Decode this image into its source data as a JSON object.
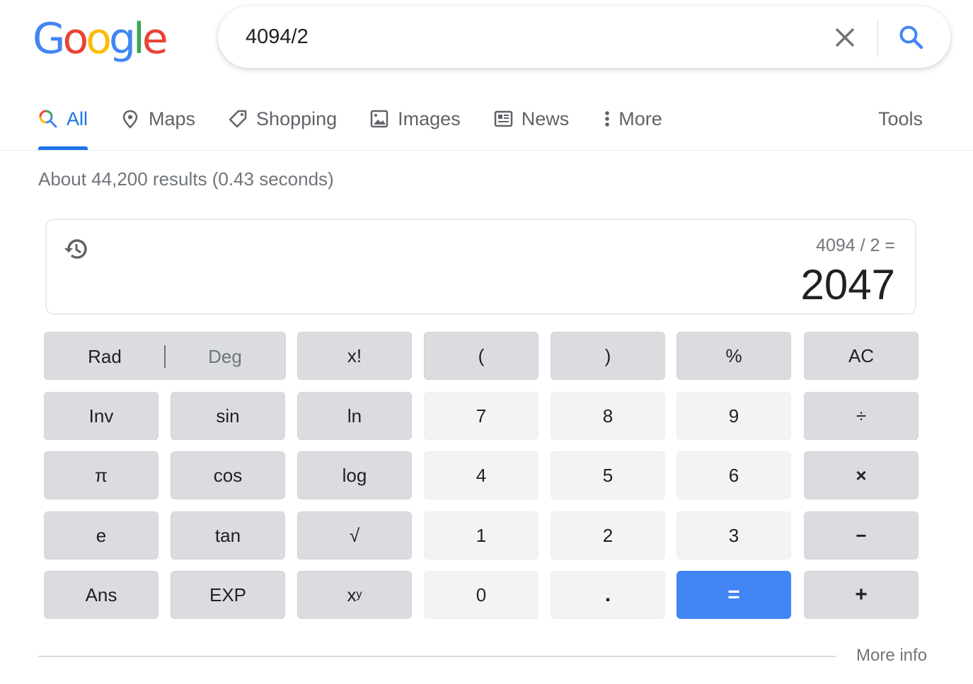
{
  "logo": {
    "letters": [
      "G",
      "o",
      "o",
      "g",
      "l",
      "e"
    ],
    "colors": [
      "#4285f4",
      "#ea4335",
      "#fbbc05",
      "#4285f4",
      "#34a853",
      "#ea4335"
    ]
  },
  "search": {
    "query": "4094/2",
    "clear_icon": "close-icon",
    "search_icon": "search-icon"
  },
  "tabs": [
    {
      "label": "All",
      "icon": "search-multicolor-icon",
      "active": true
    },
    {
      "label": "Maps",
      "icon": "map-pin-icon",
      "active": false
    },
    {
      "label": "Shopping",
      "icon": "tag-icon",
      "active": false
    },
    {
      "label": "Images",
      "icon": "image-icon",
      "active": false
    },
    {
      "label": "News",
      "icon": "newspaper-icon",
      "active": false
    },
    {
      "label": "More",
      "icon": "more-vert-icon",
      "active": false
    }
  ],
  "tools_label": "Tools",
  "result_stats": "About 44,200 results (0.43 seconds)",
  "calculator": {
    "expression": "4094 / 2 =",
    "result": "2047",
    "history_icon": "history-icon",
    "angle_mode": {
      "rad": "Rad",
      "deg": "Deg",
      "selected": "Rad"
    },
    "keys": {
      "fact": "x!",
      "lparen": "(",
      "rparen": ")",
      "percent": "%",
      "ac": "AC",
      "inv": "Inv",
      "sin": "sin",
      "ln": "ln",
      "seven": "7",
      "eight": "8",
      "nine": "9",
      "divide": "÷",
      "pi": "π",
      "cos": "cos",
      "log": "log",
      "four": "4",
      "five": "5",
      "six": "6",
      "multiply": "×",
      "e": "e",
      "tan": "tan",
      "sqrt": "√",
      "one": "1",
      "two": "2",
      "three": "3",
      "minus": "−",
      "ans": "Ans",
      "exp": "EXP",
      "pow_base": "x",
      "pow_exp": "y",
      "zero": "0",
      "dot": ".",
      "equals": "=",
      "plus": "+"
    }
  },
  "more_info": "More info",
  "colors": {
    "accent": "#1a73e8",
    "equals_button": "#4285f4",
    "function_key": "#dadce0",
    "number_key": "#f1f3f4"
  }
}
